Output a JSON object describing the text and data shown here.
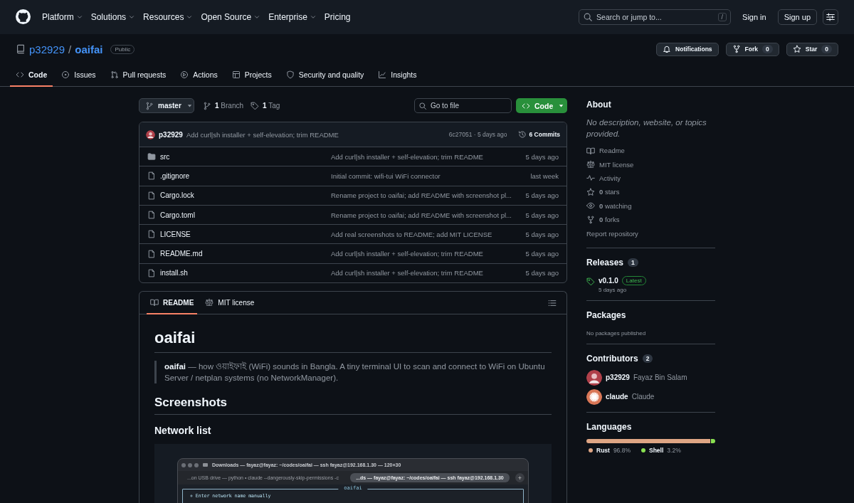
{
  "header": {
    "nav": [
      {
        "label": "Platform",
        "dropdown": true
      },
      {
        "label": "Solutions",
        "dropdown": true
      },
      {
        "label": "Resources",
        "dropdown": true
      },
      {
        "label": "Open Source",
        "dropdown": true
      },
      {
        "label": "Enterprise",
        "dropdown": true
      },
      {
        "label": "Pricing",
        "dropdown": false
      }
    ],
    "search": {
      "placeholder": "Search or jump to...",
      "shortcut": "/"
    },
    "sign_in": "Sign in",
    "sign_up": "Sign up"
  },
  "repo": {
    "owner": "p32929",
    "separator": "/",
    "name": "oaifai",
    "visibility": "Public",
    "actions": [
      {
        "kind": "bell",
        "label": "Notifications"
      },
      {
        "kind": "fork",
        "label": "Fork",
        "count": "0"
      },
      {
        "kind": "star",
        "label": "Star",
        "count": "0"
      }
    ]
  },
  "tabs": [
    {
      "kind": "code",
      "label": "Code",
      "selected": true
    },
    {
      "kind": "issue",
      "label": "Issues",
      "selected": false
    },
    {
      "kind": "pull",
      "label": "Pull requests",
      "selected": false
    },
    {
      "kind": "play",
      "label": "Actions",
      "selected": false
    },
    {
      "kind": "table",
      "label": "Projects",
      "selected": false
    },
    {
      "kind": "shield",
      "label": "Security and quality",
      "selected": false
    },
    {
      "kind": "graph",
      "label": "Insights",
      "selected": false
    }
  ],
  "branch_bar": {
    "branch": "master",
    "branches": "**1** Branch",
    "tags": "**1** Tag",
    "file_search": {
      "placeholder": "Go to file"
    },
    "code_button": "Code"
  },
  "latest_commit": {
    "author": "p32929",
    "message": "Add curl|sh installer + self-elevation; trim README",
    "meta": "6c27051 · 5 days ago",
    "commits": "6 Commits"
  },
  "files": [
    {
      "kind": "folder",
      "name": "src",
      "message": "Add curl|sh installer + self-elevation; trim README",
      "age": "5 days ago"
    },
    {
      "kind": "file",
      "name": ".gitignore",
      "message": "Initial commit: wifi-tui WiFi connector",
      "age": "last week"
    },
    {
      "kind": "file",
      "name": "Cargo.lock",
      "message": "Rename project to oaifai; add README with screenshot pl...",
      "age": "5 days ago"
    },
    {
      "kind": "file",
      "name": "Cargo.toml",
      "message": "Rename project to oaifai; add README with screenshot pl...",
      "age": "5 days ago"
    },
    {
      "kind": "file",
      "name": "LICENSE",
      "message": "Add real screenshots to README; add MIT LICENSE",
      "age": "5 days ago"
    },
    {
      "kind": "file",
      "name": "README.md",
      "message": "Add curl|sh installer + self-elevation; trim README",
      "age": "5 days ago"
    },
    {
      "kind": "file",
      "name": "install.sh",
      "message": "Add curl|sh installer + self-elevation; trim README",
      "age": "5 days ago"
    }
  ],
  "readme": {
    "tabs": [
      {
        "kind": "book",
        "label": "README",
        "selected": true
      },
      {
        "kind": "law",
        "label": "MIT license",
        "selected": false
      }
    ],
    "title": "oaifai",
    "quote": "**oaifai** — how ওয়াইফাই (WiFi) sounds in Bangla. A tiny terminal UI to scan and connect to WiFi on Ubuntu Server / netplan systems (no NetworkManager).",
    "h2": "Screenshots",
    "h3": "Network list",
    "screenshot": {
      "title": "Downloads — fayaz@fayaz: ~/codes/oaifai — ssh fayaz@192.168.1.30 — 120×30",
      "tabs": [
        {
          "label": "...on USB drive — python • claude --dangerously-skip-permissions -c",
          "selected": false
        },
        {
          "label": "...ds — fayaz@fayaz: ~/codes/oaifai — ssh fayaz@192.168.1.30",
          "selected": true
        }
      ],
      "add": "+",
      "panel_title": "oaifai",
      "lines": [
        "+  Enter network name manually"
      ]
    }
  },
  "sidebar": {
    "about": {
      "title": "About",
      "description": "No description, website, or topics provided.",
      "links": [
        {
          "kind": "book",
          "label": "Readme"
        },
        {
          "kind": "law",
          "label": "MIT license"
        },
        {
          "kind": "pulse",
          "label": "Activity"
        },
        {
          "kind": "star",
          "label": "**0** stars"
        },
        {
          "kind": "eye",
          "label": "**0** watching"
        },
        {
          "kind": "fork",
          "label": "**0** forks"
        }
      ],
      "report": "Report repository"
    },
    "releases": {
      "title": "Releases",
      "count": "1",
      "items": [
        {
          "version": "v0.1.0",
          "badge": "Latest",
          "age": "5 days ago"
        }
      ]
    },
    "packages": {
      "title": "Packages",
      "empty": "No packages published"
    },
    "contributors": {
      "title": "Contributors",
      "count": "2",
      "people": [
        {
          "kind": "photo",
          "login": "p32929",
          "name": "Fayaz Bin Salam"
        },
        {
          "kind": "burst",
          "login": "claude",
          "name": "Claude"
        }
      ]
    },
    "languages": {
      "title": "Languages",
      "items": [
        {
          "name": "Rust",
          "percent": "96.8%",
          "color": "#dea584"
        },
        {
          "name": "Shell",
          "percent": "3.2%",
          "color": "#89e051"
        }
      ]
    }
  }
}
